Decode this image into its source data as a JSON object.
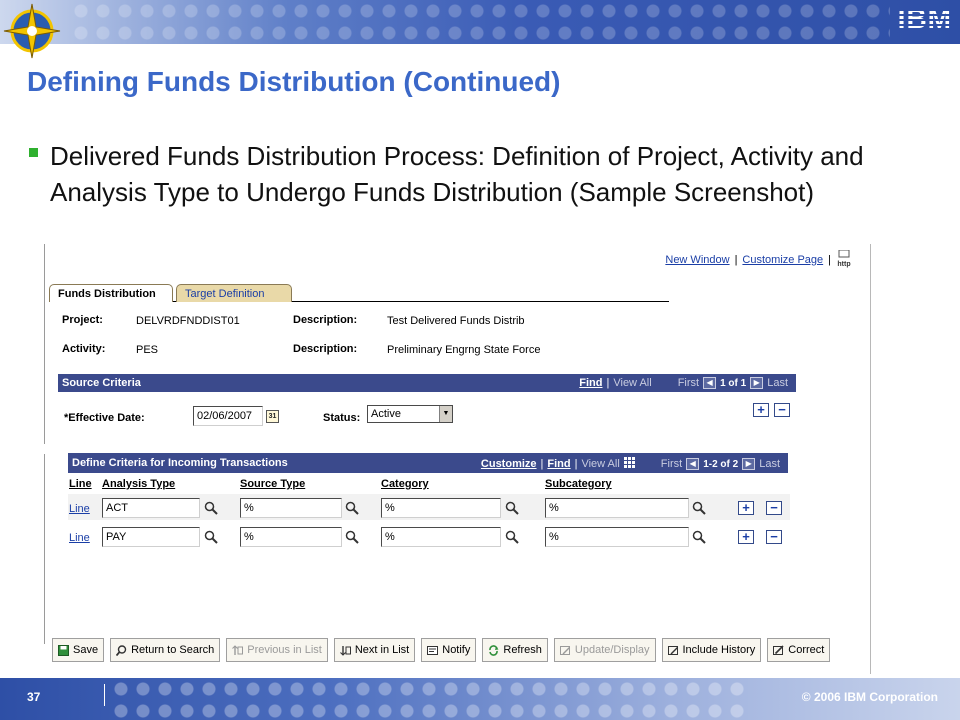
{
  "slide": {
    "title": "Defining Funds Distribution (Continued)",
    "bullet": "Delivered Funds Distribution Process: Definition of Project, Activity and Analysis Type to Undergo Funds Distribution (Sample Screenshot)",
    "page_number": "37",
    "copyright": "© 2006 IBM Corporation",
    "brand": "IBM",
    "accent_title": "#3b68c8",
    "bullet_color": "#2fb02f"
  },
  "screen": {
    "links": {
      "new_window": "New Window",
      "separator": "|",
      "customize_page": "Customize Page",
      "http": "http"
    },
    "tabs": [
      {
        "label": "Funds Distribution",
        "active": true
      },
      {
        "label": "Target Definition",
        "active": false
      }
    ],
    "header": {
      "project_label": "Project:",
      "project_value": "DELVRDFNDDIST01",
      "desc1_label": "Description:",
      "desc1_value": "Test Delivered Funds Distrib",
      "activity_label": "Activity:",
      "activity_value": "PES",
      "desc2_label": "Description:",
      "desc2_value": "Preliminary Engrng State Force"
    },
    "source_criteria": {
      "title": "Source Criteria",
      "find": "Find",
      "view_all": "View All",
      "first": "First",
      "count": "1 of 1",
      "last": "Last",
      "effective_date_label": "*Effective Date:",
      "effective_date_value": "02/06/2007",
      "calendar_icon_text": "31",
      "status_label": "Status:",
      "status_value": "Active"
    },
    "criteria_grid": {
      "title": "Define Criteria for Incoming Transactions",
      "customize": "Customize",
      "find": "Find",
      "view_all": "View All",
      "first": "First",
      "count": "1-2 of 2",
      "last": "Last",
      "columns": [
        "Line",
        "Analysis Type",
        "Source Type",
        "Category",
        "Subcategory"
      ],
      "rows": [
        {
          "line": "Line",
          "analysis_type": "ACT",
          "source_type": "%",
          "category": "%",
          "subcategory": "%"
        },
        {
          "line": "Line",
          "analysis_type": "PAY",
          "source_type": "%",
          "category": "%",
          "subcategory": "%"
        }
      ]
    },
    "toolbar": [
      {
        "label": "Save",
        "enabled": true
      },
      {
        "label": "Return to Search",
        "enabled": true
      },
      {
        "label": "Previous in List",
        "enabled": false
      },
      {
        "label": "Next in List",
        "enabled": true
      },
      {
        "label": "Notify",
        "enabled": true
      },
      {
        "label": "Refresh",
        "enabled": true
      },
      {
        "label": "Update/Display",
        "enabled": false
      },
      {
        "label": "Include History",
        "enabled": true
      },
      {
        "label": "Correct",
        "enabled": true
      }
    ],
    "colors": {
      "section_bar": "#3b4a8c",
      "link": "#1a3ea6",
      "tab_inactive": "#e9d9a8"
    }
  }
}
